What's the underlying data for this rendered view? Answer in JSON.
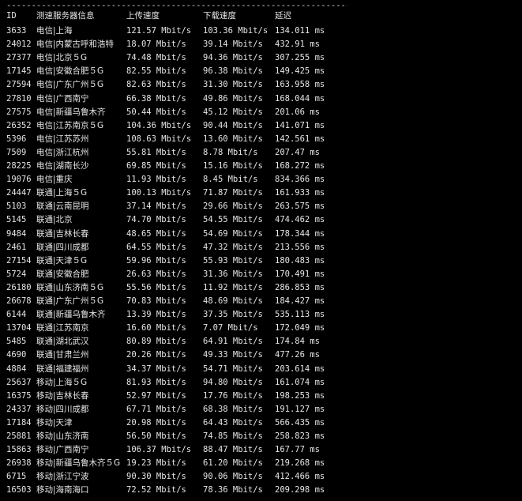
{
  "divider": "------------------------------------------------------------------------",
  "headers": {
    "id": "ID",
    "name": "测速服务器信息",
    "upload": "上传速度",
    "download": "下载速度",
    "latency": "延迟"
  },
  "rows": [
    {
      "id": "3633",
      "name": "电信|上海",
      "up": "121.57 Mbit/s",
      "down": "103.36 Mbit/s",
      "lat": "134.011 ms"
    },
    {
      "id": "24012",
      "name": "电信|内蒙古呼和浩特",
      "up": "18.07 Mbit/s",
      "down": "39.14 Mbit/s",
      "lat": "432.91 ms"
    },
    {
      "id": "27377",
      "name": "电信|北京５G",
      "up": "74.48 Mbit/s",
      "down": "94.36 Mbit/s",
      "lat": "307.255 ms"
    },
    {
      "id": "17145",
      "name": "电信|安徽合肥５G",
      "up": "82.55 Mbit/s",
      "down": "96.38 Mbit/s",
      "lat": "149.425 ms"
    },
    {
      "id": "27594",
      "name": "电信|广东广州５G",
      "up": "82.63 Mbit/s",
      "down": "31.30 Mbit/s",
      "lat": "163.958 ms"
    },
    {
      "id": "27810",
      "name": "电信|广西南宁",
      "up": "66.38 Mbit/s",
      "down": "49.86 Mbit/s",
      "lat": "168.044 ms"
    },
    {
      "id": "27575",
      "name": "电信|新疆乌鲁木齐",
      "up": "50.44 Mbit/s",
      "down": "45.12 Mbit/s",
      "lat": "201.06 ms"
    },
    {
      "id": "26352",
      "name": "电信|江苏南京５G",
      "up": "104.36 Mbit/s",
      "down": "90.44 Mbit/s",
      "lat": "141.071 ms"
    },
    {
      "id": "5396",
      "name": "电信|江苏苏州",
      "up": "108.63 Mbit/s",
      "down": "13.60 Mbit/s",
      "lat": "142.561 ms"
    },
    {
      "id": "7509",
      "name": "电信|浙江杭州",
      "up": "55.81 Mbit/s",
      "down": "8.78 Mbit/s",
      "lat": "207.47 ms"
    },
    {
      "id": "28225",
      "name": "电信|湖南长沙",
      "up": "69.85 Mbit/s",
      "down": "15.16 Mbit/s",
      "lat": "168.272 ms"
    },
    {
      "id": "19076",
      "name": "电信|重庆",
      "up": "11.93 Mbit/s",
      "down": "8.45 Mbit/s",
      "lat": "834.366 ms"
    },
    {
      "id": "24447",
      "name": "联通|上海５G",
      "up": "100.13 Mbit/s",
      "down": "71.87 Mbit/s",
      "lat": "161.933 ms"
    },
    {
      "id": "5103",
      "name": "联通|云南昆明",
      "up": "37.14 Mbit/s",
      "down": "29.66 Mbit/s",
      "lat": "263.575 ms"
    },
    {
      "id": "5145",
      "name": "联通|北京",
      "up": "74.70 Mbit/s",
      "down": "54.55 Mbit/s",
      "lat": "474.462 ms"
    },
    {
      "id": "9484",
      "name": "联通|吉林长春",
      "up": "48.65 Mbit/s",
      "down": "54.69 Mbit/s",
      "lat": "178.344 ms"
    },
    {
      "id": "2461",
      "name": "联通|四川成都",
      "up": "64.55 Mbit/s",
      "down": "47.32 Mbit/s",
      "lat": "213.556 ms"
    },
    {
      "id": "27154",
      "name": "联通|天津５G",
      "up": "59.96 Mbit/s",
      "down": "55.93 Mbit/s",
      "lat": "180.483 ms"
    },
    {
      "id": "5724",
      "name": "联通|安徽合肥",
      "up": "26.63 Mbit/s",
      "down": "31.36 Mbit/s",
      "lat": "170.491 ms"
    },
    {
      "id": "26180",
      "name": "联通|山东济南５G",
      "up": "55.56 Mbit/s",
      "down": "11.92 Mbit/s",
      "lat": "286.853 ms"
    },
    {
      "id": "26678",
      "name": "联通|广东广州５G",
      "up": "70.83 Mbit/s",
      "down": "48.69 Mbit/s",
      "lat": "184.427 ms"
    },
    {
      "id": "6144",
      "name": "联通|新疆乌鲁木齐",
      "up": "13.39 Mbit/s",
      "down": "37.35 Mbit/s",
      "lat": "535.113 ms"
    },
    {
      "id": "13704",
      "name": "联通|江苏南京",
      "up": "16.60 Mbit/s",
      "down": "7.07 Mbit/s",
      "lat": "172.049 ms"
    },
    {
      "id": "5485",
      "name": "联通|湖北武汉",
      "up": "80.89 Mbit/s",
      "down": "64.91 Mbit/s",
      "lat": "174.84 ms"
    },
    {
      "id": "4690",
      "name": "联通|甘肃兰州",
      "up": "20.26 Mbit/s",
      "down": "49.33 Mbit/s",
      "lat": "477.26 ms"
    },
    {
      "id": "4884",
      "name": "联通|福建福州",
      "up": "34.37 Mbit/s",
      "down": "54.71 Mbit/s",
      "lat": "203.614 ms"
    },
    {
      "id": "25637",
      "name": "移动|上海５G",
      "up": "81.93 Mbit/s",
      "down": "94.80 Mbit/s",
      "lat": "161.074 ms"
    },
    {
      "id": "16375",
      "name": "移动|吉林长春",
      "up": "52.97 Mbit/s",
      "down": "17.76 Mbit/s",
      "lat": "198.253 ms"
    },
    {
      "id": "24337",
      "name": "移动|四川成都",
      "up": "67.71 Mbit/s",
      "down": "68.38 Mbit/s",
      "lat": "191.127 ms"
    },
    {
      "id": "17184",
      "name": "移动|天津",
      "up": "20.98 Mbit/s",
      "down": "64.43 Mbit/s",
      "lat": "566.435 ms"
    },
    {
      "id": "25881",
      "name": "移动|山东济南",
      "up": "56.50 Mbit/s",
      "down": "74.85 Mbit/s",
      "lat": "258.823 ms"
    },
    {
      "id": "15863",
      "name": "移动|广西南宁",
      "up": "106.37 Mbit/s",
      "down": "88.47 Mbit/s",
      "lat": "167.77 ms"
    },
    {
      "id": "26938",
      "name": "移动|新疆乌鲁木齐５G",
      "up": "19.23 Mbit/s",
      "down": "61.20 Mbit/s",
      "lat": "219.268 ms"
    },
    {
      "id": "6715",
      "name": "移动|浙江宁波",
      "up": "90.30 Mbit/s",
      "down": "90.06 Mbit/s",
      "lat": "412.466 ms"
    },
    {
      "id": "16503",
      "name": "移动|海南海口",
      "up": "72.52 Mbit/s",
      "down": "78.36 Mbit/s",
      "lat": "209.298 ms"
    }
  ]
}
